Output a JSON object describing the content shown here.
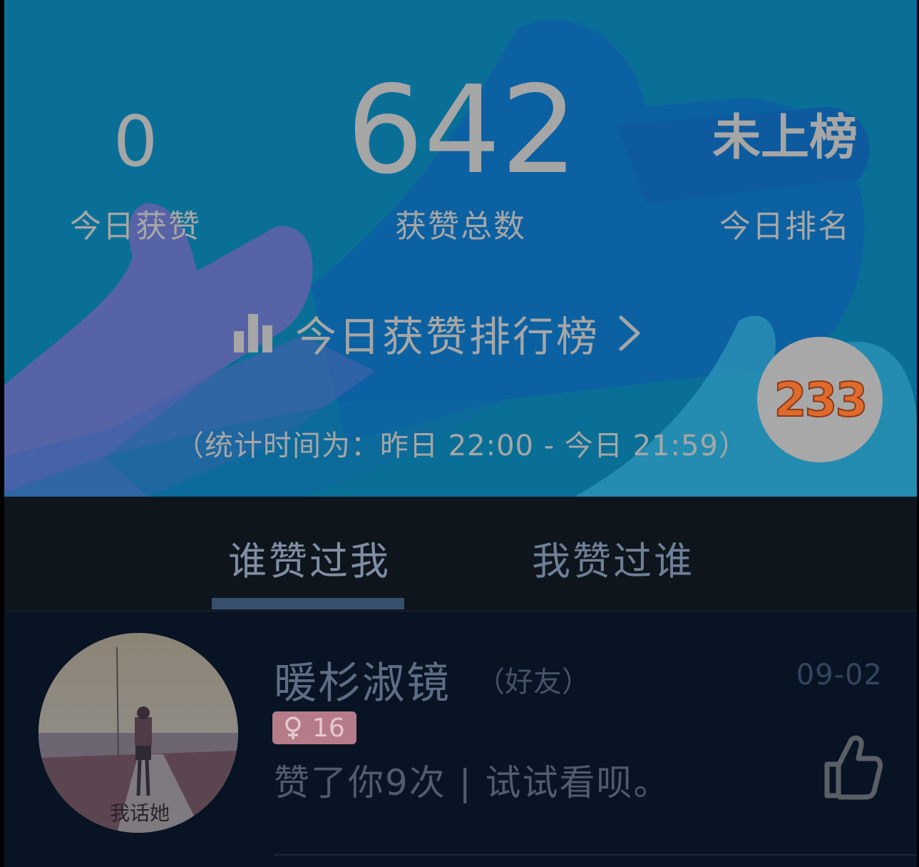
{
  "stats": {
    "today_likes": {
      "value": "0",
      "label": "今日获赞"
    },
    "total_likes": {
      "value": "642",
      "label": "获赞总数"
    },
    "today_rank": {
      "value": "未上榜",
      "label": "今日排名"
    }
  },
  "ranking_link": {
    "label": "今日获赞排行榜",
    "icon": "bar-chart-icon"
  },
  "stat_period": "（统计时间为：昨日 22:00 - 今日 21:59）",
  "floating_badge": "233",
  "tabs": [
    {
      "label": "谁赞过我",
      "active": true
    },
    {
      "label": "我赞过谁",
      "active": false
    }
  ],
  "list": [
    {
      "nickname": "暖杉淑镜",
      "relation": "（好友）",
      "date": "09-02",
      "age": "16",
      "gender_icon": "female-icon",
      "summary": "赞了你9次 | 试试看呗。",
      "avatar_caption": "我话她"
    }
  ],
  "colors": {
    "hero_bg": "#0a6f97",
    "tabs_bg": "#0e151d",
    "list_bg": "#081424",
    "tab_indicator": "#36506d",
    "gender_badge": "#b57b89",
    "badge_233_text": "#e06a2c"
  }
}
